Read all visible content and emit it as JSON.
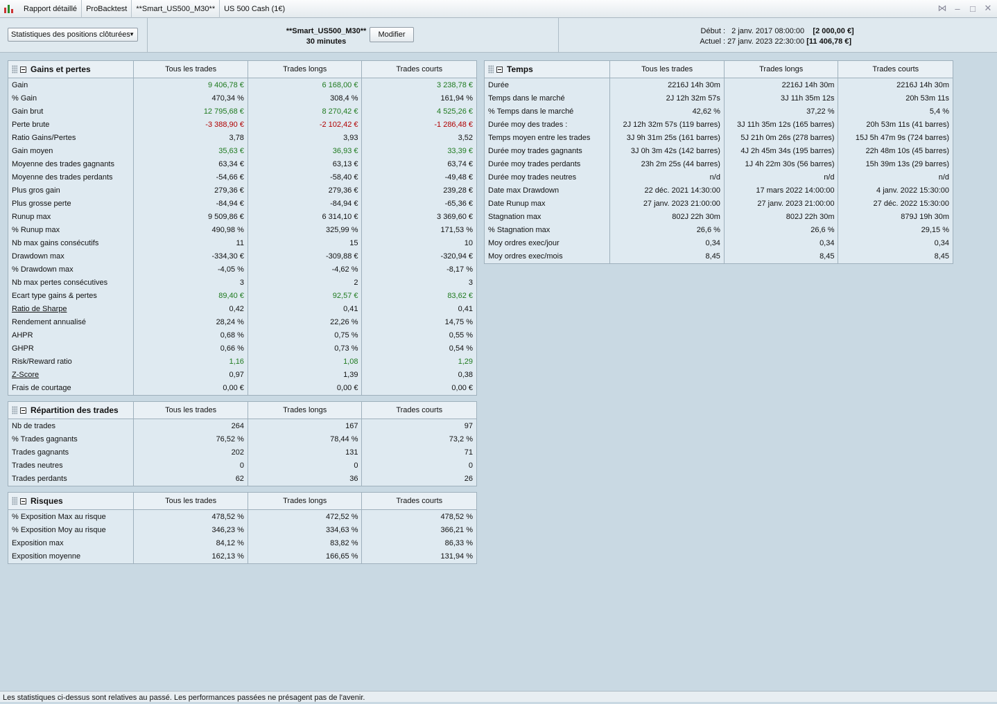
{
  "tabs": [
    "Rapport détaillé",
    "ProBacktest",
    "**Smart_US500_M30**",
    "US 500 Cash (1€)"
  ],
  "topbar": {
    "dropdown": "Statistiques des positions clôturées",
    "strategy_name": "**Smart_US500_M30**",
    "timeframe": "30 minutes",
    "modify_button": "Modifier",
    "start_label": "Début :",
    "start_value": "2 janv. 2017 08:00:00",
    "start_capital": "[2 000,00 €]",
    "current_label": "Actuel :",
    "current_value": "27 janv. 2023 22:30:00",
    "current_capital": "[11 406,78 €]"
  },
  "columns": [
    "Tous les trades",
    "Trades longs",
    "Trades courts"
  ],
  "gains": {
    "title": "Gains et pertes",
    "labels": [
      "Gain",
      "% Gain",
      "Gain brut",
      "Perte brute",
      "Ratio Gains/Pertes",
      "Gain moyen",
      "Moyenne des trades gagnants",
      "Moyenne des trades perdants",
      "Plus gros gain",
      "Plus grosse perte",
      "Runup max",
      "% Runup max",
      "Nb max gains consécutifs",
      "Drawdown max",
      "% Drawdown max",
      "Nb max pertes consécutives",
      "Ecart type gains & pertes",
      "Ratio de Sharpe",
      "Rendement annualisé",
      "AHPR",
      "GHPR",
      "Risk/Reward ratio",
      "Z-Score",
      "Frais de courtage"
    ],
    "all": [
      "9 406,78 €",
      "470,34 %",
      "12 795,68 €",
      "-3 388,90 €",
      "3,78",
      "35,63 €",
      "63,34 €",
      "-54,66 €",
      "279,36 €",
      "-84,94 €",
      "9 509,86 €",
      "490,98 %",
      "11",
      "-334,30 €",
      "-4,05 %",
      "3",
      "89,40 €",
      "0,42",
      "28,24 %",
      "0,68 %",
      "0,66 %",
      "1,16",
      "0,97",
      "0,00 €"
    ],
    "long": [
      "6 168,00 €",
      "308,4 %",
      "8 270,42 €",
      "-2 102,42 €",
      "3,93",
      "36,93 €",
      "63,13 €",
      "-58,40 €",
      "279,36 €",
      "-84,94 €",
      "6 314,10 €",
      "325,99 %",
      "15",
      "-309,88 €",
      "-4,62 %",
      "2",
      "92,57 €",
      "0,41",
      "22,26 %",
      "0,75 %",
      "0,73 %",
      "1,08",
      "1,39",
      "0,00 €"
    ],
    "short": [
      "3 238,78 €",
      "161,94 %",
      "4 525,26 €",
      "-1 286,48 €",
      "3,52",
      "33,39 €",
      "63,74 €",
      "-49,48 €",
      "239,28 €",
      "-65,36 €",
      "3 369,60 €",
      "171,53 %",
      "10",
      "-320,94 €",
      "-8,17 %",
      "3",
      "83,62 €",
      "0,41",
      "14,75 %",
      "0,55 %",
      "0,54 %",
      "1,29",
      "0,38",
      "0,00 €"
    ]
  },
  "repartition": {
    "title": "Répartition des trades",
    "labels": [
      "Nb de trades",
      "% Trades gagnants",
      "Trades gagnants",
      "Trades neutres",
      "Trades perdants"
    ],
    "all": [
      "264",
      "76,52 %",
      "202",
      "0",
      "62"
    ],
    "long": [
      "167",
      "78,44 %",
      "131",
      "0",
      "36"
    ],
    "short": [
      "97",
      "73,2 %",
      "71",
      "0",
      "26"
    ]
  },
  "risques": {
    "title": "Risques",
    "labels": [
      "% Exposition Max au risque",
      "% Exposition Moy au risque",
      "Exposition max",
      "Exposition moyenne"
    ],
    "all": [
      "478,52 %",
      "346,23 %",
      "84,12 %",
      "162,13 %"
    ],
    "long": [
      "472,52 %",
      "334,63 %",
      "83,82 %",
      "166,65 %"
    ],
    "short": [
      "478,52 %",
      "366,21 %",
      "86,33 %",
      "131,94 %"
    ]
  },
  "temps": {
    "title": "Temps",
    "labels": [
      "Durée",
      "Temps dans le marché",
      "% Temps dans le marché",
      "Durée moy des trades :",
      "Temps moyen entre les trades",
      "Durée moy trades gagnants",
      "Durée moy trades perdants",
      "Durée moy trades neutres",
      "Date max Drawdown",
      "Date Runup max",
      "Stagnation max",
      "% Stagnation max",
      "Moy ordres exec/jour",
      "Moy ordres exec/mois"
    ],
    "all": [
      "2216J 14h 30m",
      "2J 12h 32m 57s",
      "42,62 %",
      "2J 12h 32m 57s (119 barres)",
      "3J 9h 31m 25s (161 barres)",
      "3J 0h 3m 42s (142 barres)",
      "23h 2m 25s (44 barres)",
      "n/d",
      "22 déc. 2021 14:30:00",
      "27 janv. 2023 21:00:00",
      "802J 22h 30m",
      "26,6 %",
      "0,34",
      "8,45"
    ],
    "long": [
      "2216J 14h 30m",
      "3J 11h 35m 12s",
      "37,22 %",
      "3J 11h 35m 12s (165 barres)",
      "5J 21h 0m 26s (278 barres)",
      "4J 2h 45m 34s (195 barres)",
      "1J 4h 22m 30s (56 barres)",
      "n/d",
      "17 mars 2022 14:00:00",
      "27 janv. 2023 21:00:00",
      "802J 22h 30m",
      "26,6 %",
      "0,34",
      "8,45"
    ],
    "short": [
      "2216J 14h 30m",
      "20h 53m 11s",
      "5,4 %",
      "20h 53m 11s (41 barres)",
      "15J 5h 47m 9s (724 barres)",
      "22h 48m 10s (45 barres)",
      "15h 39m 13s (29 barres)",
      "n/d",
      "4 janv. 2022 15:30:00",
      "27 déc. 2022 15:30:00",
      "879J 19h 30m",
      "29,15 %",
      "0,34",
      "8,45"
    ]
  },
  "colors": {
    "positive": "#1f7a1f",
    "negative": "#b00000"
  },
  "footer": "Les statistiques ci-dessus sont relatives au passé. Les performances passées ne présagent pas de l'avenir."
}
